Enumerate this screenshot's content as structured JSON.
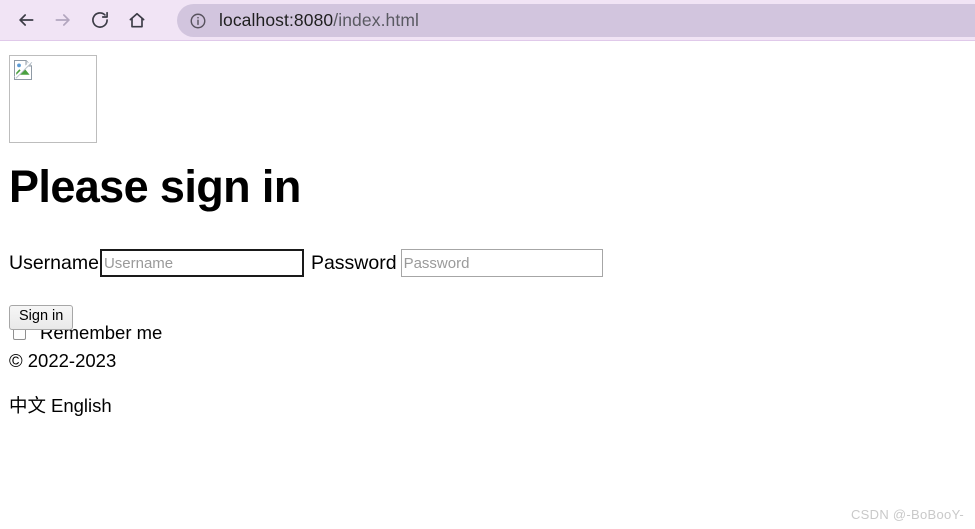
{
  "browser": {
    "nav": [
      {
        "name": "back-icon",
        "label": "Back",
        "enabled": true
      },
      {
        "name": "forward-icon",
        "label": "Forward",
        "enabled": false
      },
      {
        "name": "reload-icon",
        "label": "Reload",
        "enabled": true
      },
      {
        "name": "home-icon",
        "label": "Home",
        "enabled": true
      }
    ],
    "omnibox": {
      "security_icon": "info-circle-icon",
      "host": "localhost:8080",
      "path": "/index.html",
      "full_url": "localhost:8080/index.html"
    },
    "colors": {
      "toolbar_background": "#f1e4f5",
      "omnibox_background": "#d2c5de",
      "toolbar_border": "#e0c9ea"
    }
  },
  "page": {
    "logo": {
      "name": "broken-image-placeholder",
      "alt": "",
      "state": "broken"
    },
    "heading": "Please sign in",
    "form": {
      "username": {
        "label": "Username",
        "placeholder": "Username",
        "value": "",
        "focused": true
      },
      "password": {
        "label": "Password",
        "placeholder": "Password",
        "value": "",
        "focused": false
      },
      "remember": {
        "label": "Remember me",
        "checked": false
      },
      "submit_label": "Sign in"
    },
    "footer": {
      "copyright": "© 2022-2023",
      "languages": [
        {
          "label": "中文"
        },
        {
          "label": "English"
        }
      ]
    }
  },
  "watermark": "CSDN @-BoBooY-"
}
